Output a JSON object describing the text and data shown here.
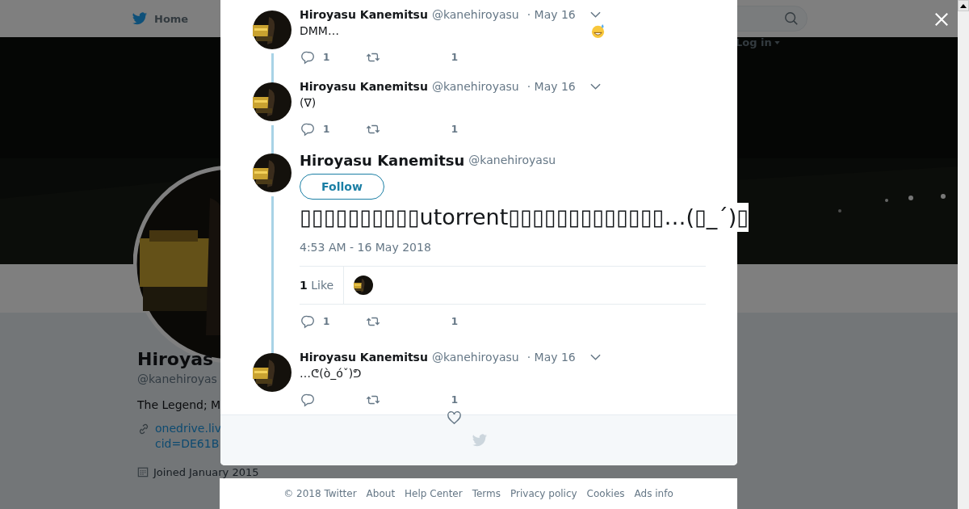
{
  "nav": {
    "home": "Home",
    "login": "Log in"
  },
  "profile": {
    "name": "Hiroyas",
    "handle": "@kanehiroyas",
    "bio": "The Legend; M",
    "link_lines": [
      "onedrive.liv",
      "cid=DE61B"
    ],
    "joined": "Joined January 2015"
  },
  "thread": [
    {
      "kind": "reply",
      "name": "Hiroyasu Kanemitsu",
      "handle": "@kanehiroyasu",
      "date": "· May 16",
      "text": "DMM…",
      "emoji": true,
      "replies": "1",
      "likes": "1"
    },
    {
      "kind": "reply",
      "name": "Hiroyasu Kanemitsu",
      "handle": "@kanehiroyasu",
      "date": "· May 16",
      "text": "(∇)",
      "replies": "1",
      "likes": "1"
    },
    {
      "kind": "focused",
      "name": "Hiroyasu Kanemitsu",
      "handle": "@kanehiroyasu",
      "follow": "Follow",
      "text": "▯▯▯▯▯▯▯▯▯▯utorrent▯▯▯▯▯▯▯▯▯▯▯▯▯…(▯_´)▯",
      "time": "4:53 AM - 16 May 2018",
      "like_count": "1",
      "like_label": "Like",
      "replies": "1",
      "likes": "1"
    },
    {
      "kind": "reply",
      "name": "Hiroyasu Kanemitsu",
      "handle": "@kanehiroyasu",
      "date": "· May 16",
      "text": "…ᕦ(ò_óˇ)ᕤ",
      "likes": "1"
    }
  ],
  "footer": [
    "© 2018 Twitter",
    "About",
    "Help Center",
    "Terms",
    "Privacy policy",
    "Cookies",
    "Ads info"
  ]
}
